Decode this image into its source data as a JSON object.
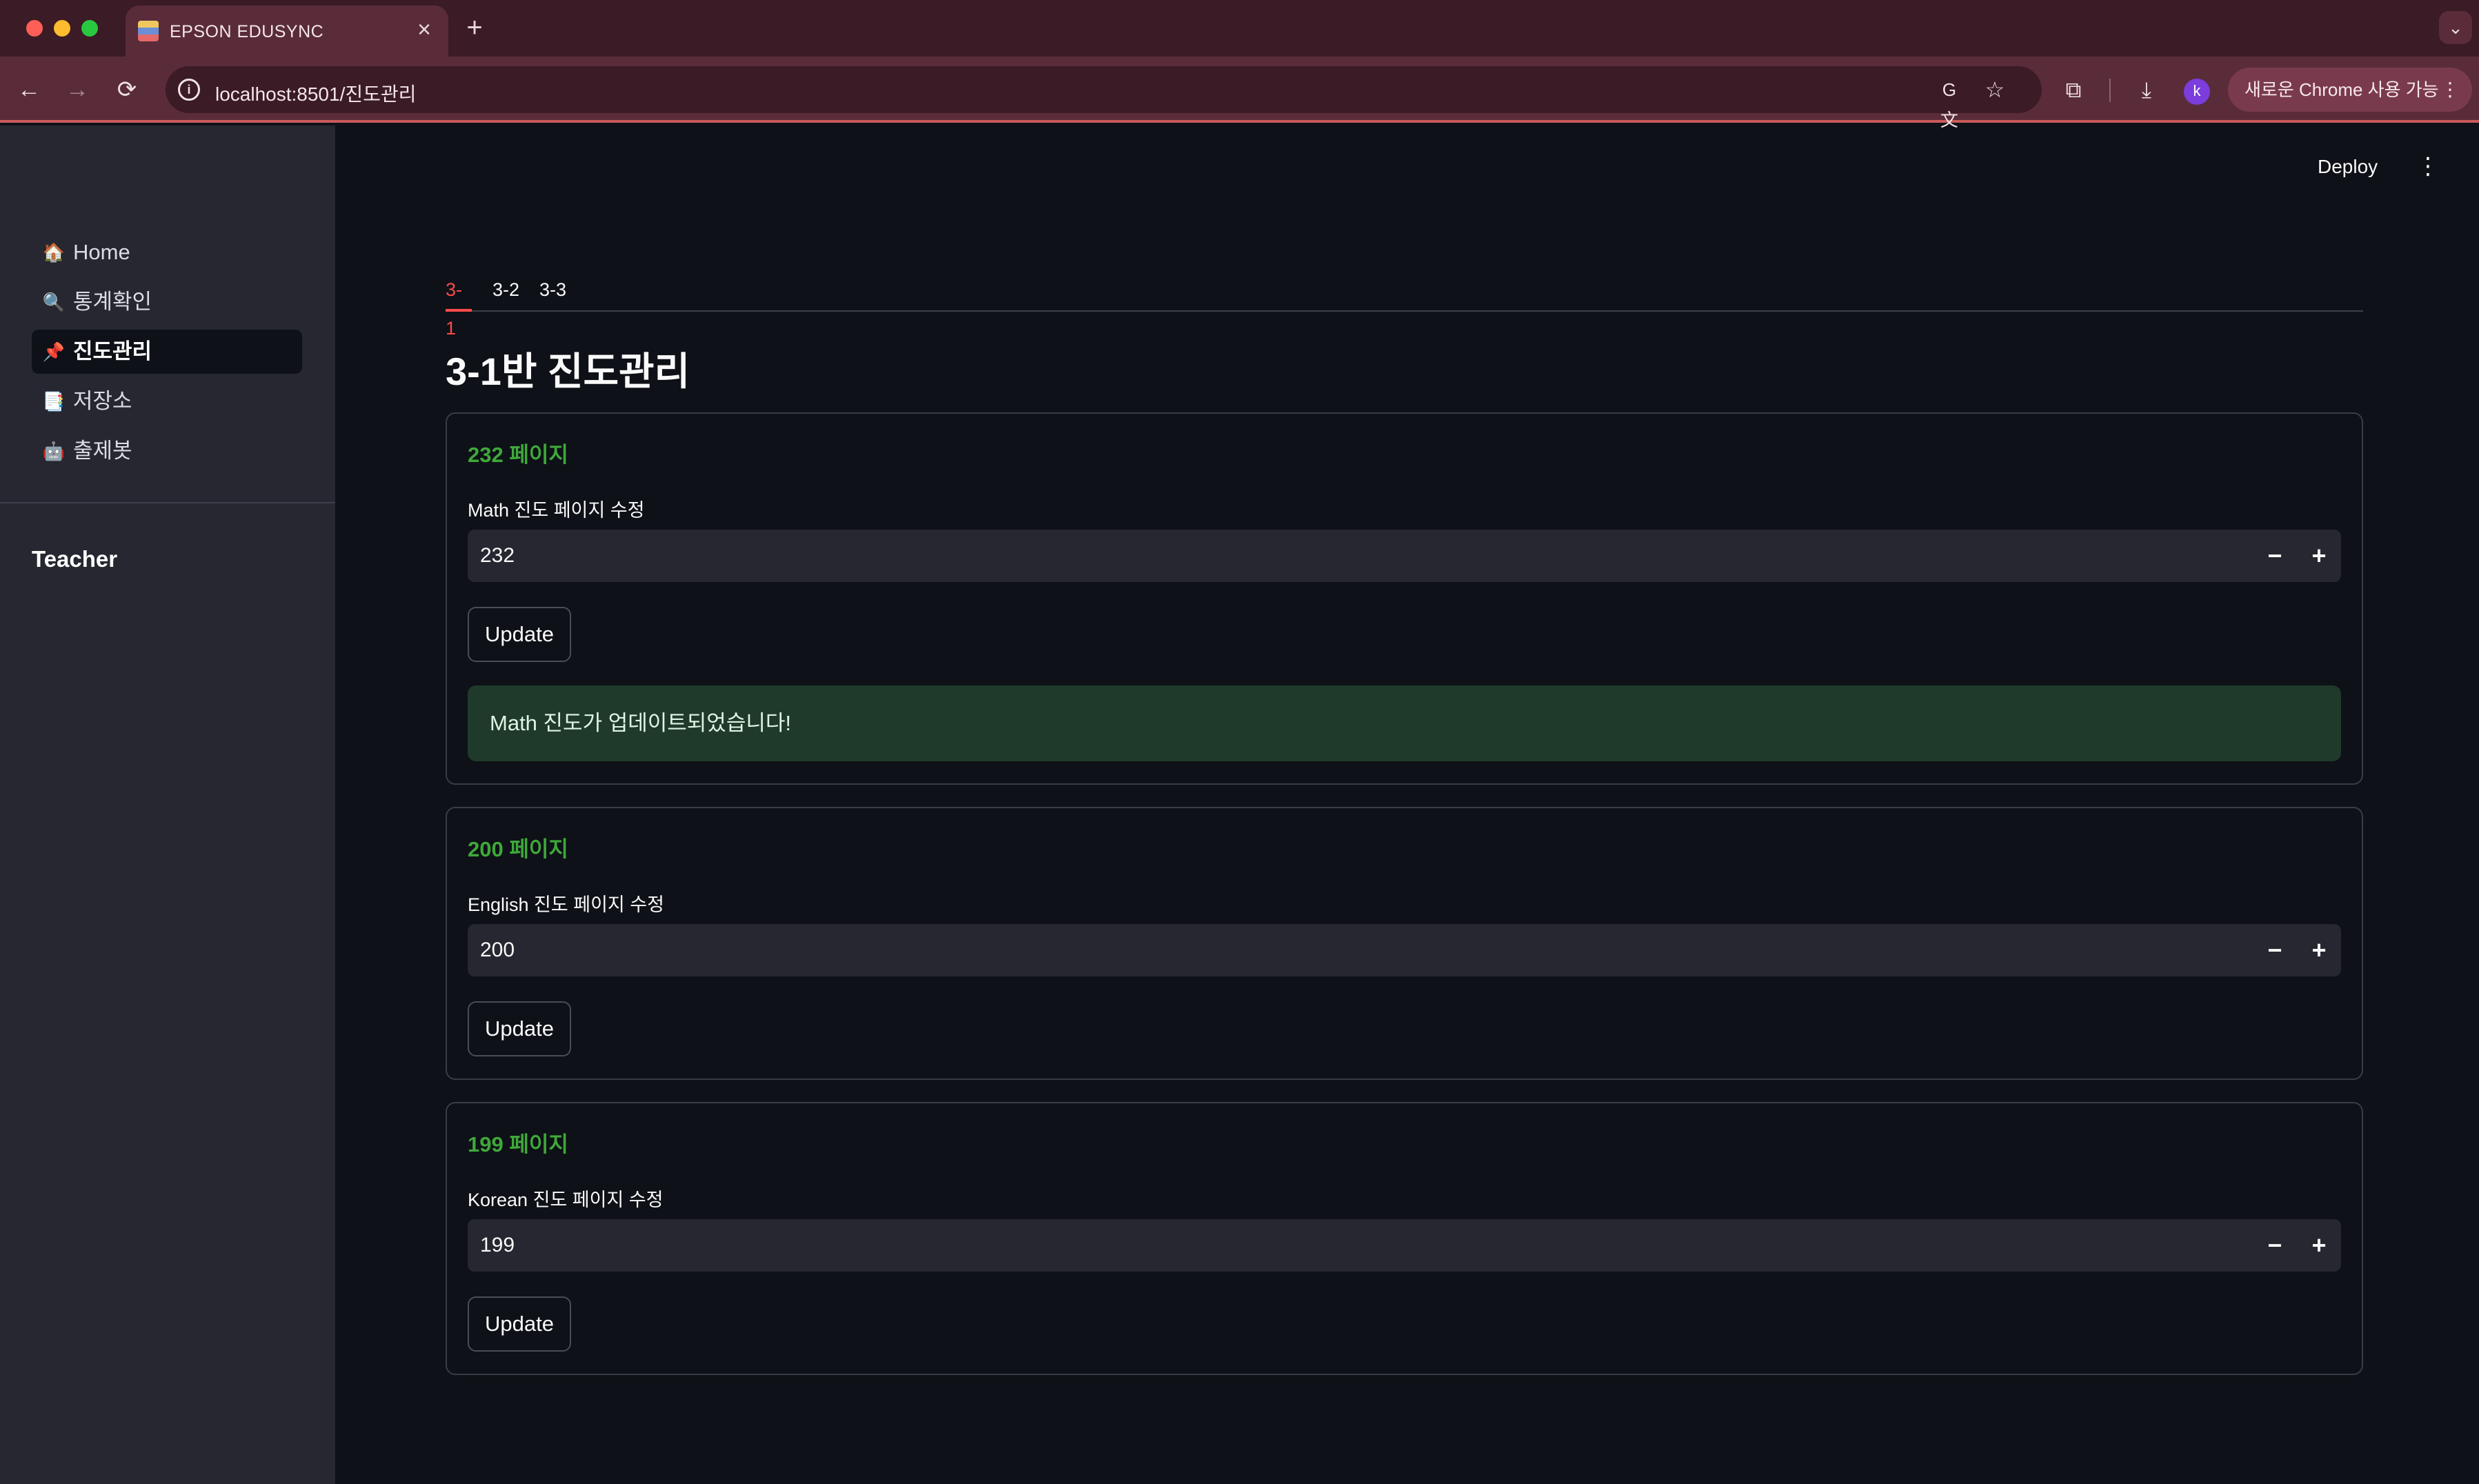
{
  "browser": {
    "tab_title": "EPSON EDUSYNC",
    "url": "localhost:8501/진도관리",
    "profile_initial": "k",
    "promo_label": "새로운 Chrome 사용 가능",
    "icons": {
      "back": "←",
      "forward": "→",
      "reload": "⟳",
      "close": "×",
      "new_tab": "+",
      "tab_menu": "⌄",
      "info": "i",
      "translate": "G文",
      "star": "☆",
      "extensions": "⧉",
      "download": "⤓",
      "more": "⋮"
    }
  },
  "header": {
    "deploy_label": "Deploy",
    "menu_icon": "⋮"
  },
  "sidebar": {
    "items": [
      {
        "icon": "🏠",
        "label": "Home"
      },
      {
        "icon": "🔍",
        "label": "통계확인"
      },
      {
        "icon": "📌",
        "label": "진도관리"
      },
      {
        "icon": "📑",
        "label": "저장소"
      },
      {
        "icon": "🤖",
        "label": "출제봇"
      }
    ],
    "active_index": 2,
    "role_label": "Teacher"
  },
  "tabs": [
    {
      "label": "3-1",
      "active": true
    },
    {
      "label": "3-2",
      "active": false
    },
    {
      "label": "3-3",
      "active": false
    }
  ],
  "page_title": "3-1반 진도관리",
  "cards": [
    {
      "page_count": "232 페이지",
      "field_label": "Math 진도 페이지 수정",
      "value": "232",
      "button_label": "Update",
      "success_message": "Math 진도가 업데이트되었습니다!"
    },
    {
      "page_count": "200 페이지",
      "field_label": "English 진도 페이지 수정",
      "value": "200",
      "button_label": "Update"
    },
    {
      "page_count": "199 페이지",
      "field_label": "Korean 진도 페이지 수정",
      "value": "199",
      "button_label": "Update"
    }
  ],
  "stepper": {
    "minus": "−",
    "plus": "+"
  },
  "colors": {
    "accent": "#ff4b4b",
    "page_count_green": "#3fa83a",
    "success_bg": "#1f3a2a",
    "app_bg": "#0e1117",
    "sidebar_bg": "#262730",
    "browser_frame": "#5a2c3a"
  }
}
